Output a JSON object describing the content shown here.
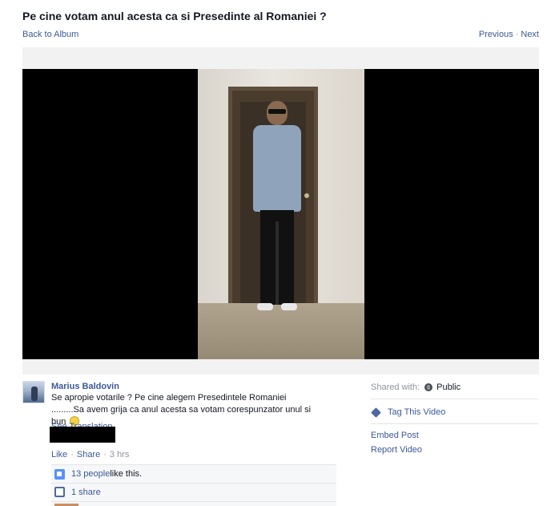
{
  "header": {
    "title": "Pe cine votam anul acesta ca si Presedinte al Romaniei ?",
    "back_label": "Back to Album",
    "previous_label": "Previous",
    "separator": "·",
    "next_label": "Next"
  },
  "post": {
    "author": "Marius Baldovin",
    "message": "Se apropie votarile ? Pe cine alegem Presedintele Romaniei .........Sa avem grija ca anul acesta sa votam corespunzator unul si bun",
    "see_translation": "See Translation",
    "actions": {
      "like": "Like",
      "share": "Share",
      "dot": "·",
      "time": "3 hrs"
    },
    "likes": {
      "people": "13 people",
      "suffix": " like this."
    },
    "shares": "1 share"
  },
  "sidebar": {
    "shared_with_label": "Shared with:",
    "audience": "Public",
    "tag_video": "Tag This Video",
    "embed_post": "Embed Post",
    "report_video": "Report Video"
  },
  "colors": {
    "link": "#3b5998",
    "muted": "#90949c",
    "video_bg": "#000000"
  }
}
